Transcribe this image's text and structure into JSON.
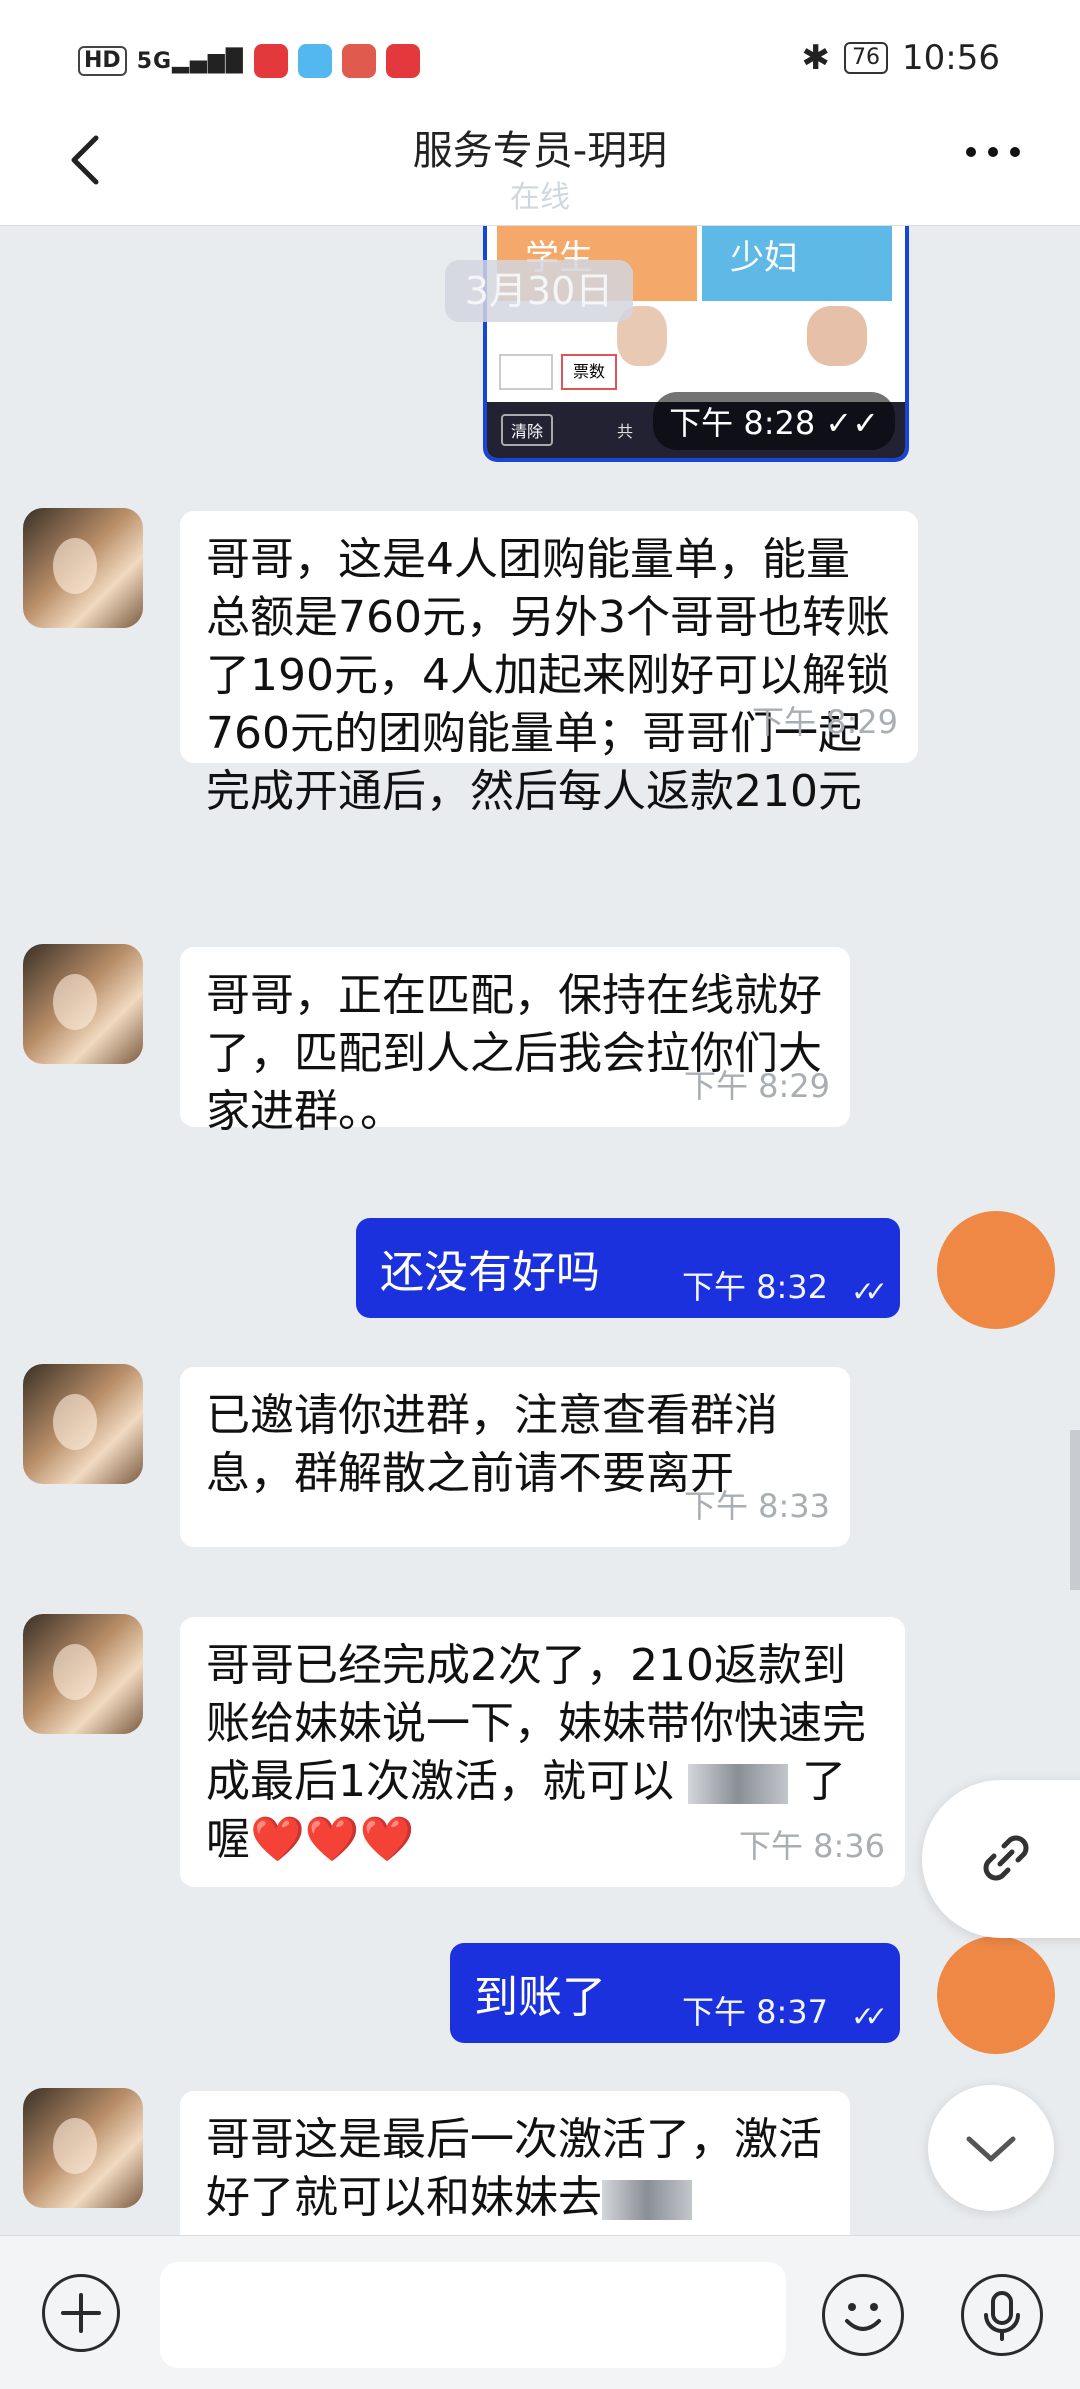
{
  "status_bar": {
    "hd": "HD",
    "signal": "5G",
    "battery": "76",
    "time": "10:56",
    "icons": [
      "hd-icon",
      "signal-icon",
      "app-icon",
      "weather-icon",
      "app-icon",
      "app-icon",
      "bluetooth-icon",
      "battery-icon"
    ]
  },
  "header": {
    "title": "服务专员-玥玥",
    "status": "在线",
    "back_icon": "chevron-left-icon",
    "more_icon": "more-icon"
  },
  "image_message": {
    "tile1_label": "学生",
    "tile2_label": "少妇",
    "box_label": "票数",
    "clear_label": "清除",
    "small_text": "共",
    "time": "下午 8:28"
  },
  "date_divider": "3月30日",
  "messages": [
    {
      "side": "received",
      "text": "哥哥，这是4人团购能量单，能量总额是760元，另外3个哥哥也转账了190元，4人加起来刚好可以解锁760元的团购能量单；哥哥们一起完成开通后，然后每人返款210元",
      "time": "下午 8:29"
    },
    {
      "side": "received",
      "text": "哥哥，正在匹配，保持在线就好了，匹配到人之后我会拉你们大家进群。。",
      "time": "下午 8:29"
    },
    {
      "side": "sent",
      "text": "还没有好吗",
      "time": "下午 8:32"
    },
    {
      "side": "received",
      "text": "已邀请你进群，注意查看群消息，群解散之前请不要离开",
      "time": "下午 8:33"
    },
    {
      "side": "received",
      "text_before": "哥哥已经完成2次了，210返款到账给妹妹说一下，妹妹带你快速完成最后1次激活，就可以",
      "text_after": "了喔",
      "hearts": "❤️❤️❤️",
      "time": "下午 8:36"
    },
    {
      "side": "sent",
      "text": "到账了",
      "time": "下午 8:37"
    },
    {
      "side": "received",
      "text": "哥哥这是最后一次激活了，激活好了就可以和妹妹去",
      "time": ""
    }
  ],
  "read_ticks": "✓✓",
  "colors": {
    "sent_bubble": "#1a31dd",
    "received_bubble": "#ffffff",
    "my_avatar": "#ef8845",
    "chat_background": "#e9ecef"
  },
  "floating": {
    "link_icon": "link-icon",
    "scroll_icon": "chevron-down-icon"
  },
  "input_bar": {
    "add_icon": "plus-icon",
    "emoji_icon": "smile-icon",
    "voice_icon": "mic-icon"
  }
}
